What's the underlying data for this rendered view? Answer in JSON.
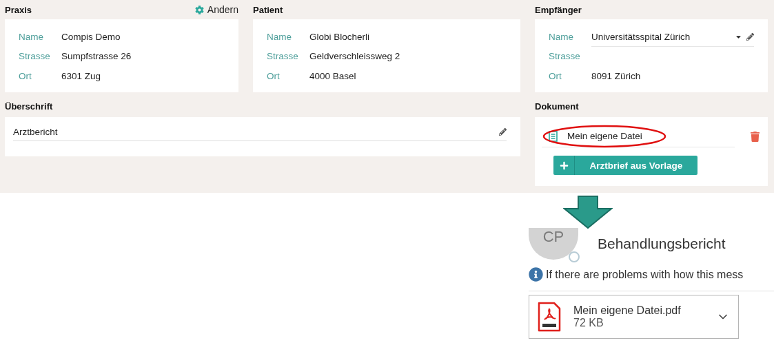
{
  "praxis": {
    "title": "Praxis",
    "action": "Andern",
    "fields": [
      {
        "label": "Name",
        "value": "Compis Demo"
      },
      {
        "label": "Strasse",
        "value": "Sumpfstrasse 26"
      },
      {
        "label": "Ort",
        "value": "6301 Zug"
      }
    ]
  },
  "patient": {
    "title": "Patient",
    "fields": [
      {
        "label": "Name",
        "value": "Globi Blocherli"
      },
      {
        "label": "Strasse",
        "value": "Geldverschleissweg 2"
      },
      {
        "label": "Ort",
        "value": "4000 Basel"
      }
    ]
  },
  "empfaenger": {
    "title": "Empfänger",
    "fields": [
      {
        "label": "Name",
        "value": "Universitätsspital Zürich",
        "kind": "dropdown"
      },
      {
        "label": "Strasse",
        "kind": "text"
      },
      {
        "label": "Ort",
        "value": "8091 Zürich",
        "kind": "text"
      }
    ]
  },
  "ueberschrift": {
    "title": "Überschrift",
    "value": "Arztbericht"
  },
  "dokument": {
    "title": "Dokument",
    "file": "Mein eigene Datei",
    "button": "Arztbrief aus Vorlage"
  },
  "email": {
    "avatar": "CP",
    "subject": "Behandlungsbericht",
    "info": "If there are problems with how this mess",
    "attachment": {
      "name": "Mein eigene Datei.pdf",
      "size": "72 KB"
    }
  }
}
